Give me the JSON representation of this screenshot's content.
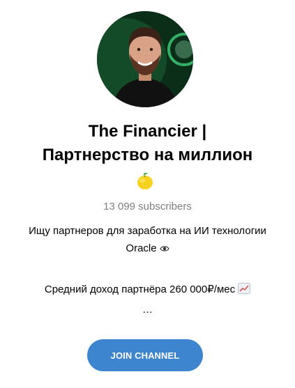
{
  "channel": {
    "title_line_1": "The Financier |",
    "title_line_2": "Партнерство на миллион",
    "emoji": "lemon-icon",
    "subscribers": "13 099 subscribers"
  },
  "description": {
    "line_1": "Ищу партнеров для заработка на ИИ технологии",
    "line_2": "Oracle",
    "line_2_icon": "eye-icon",
    "line_3": "Средний доход партнёра 260 000₽/мес",
    "line_3_icon": "chart-increasing-icon",
    "line_4": "…"
  },
  "actions": {
    "join_label": "JOIN CHANNEL"
  },
  "colors": {
    "accent": "#3d86cf",
    "subtitle": "#7d7f81"
  }
}
